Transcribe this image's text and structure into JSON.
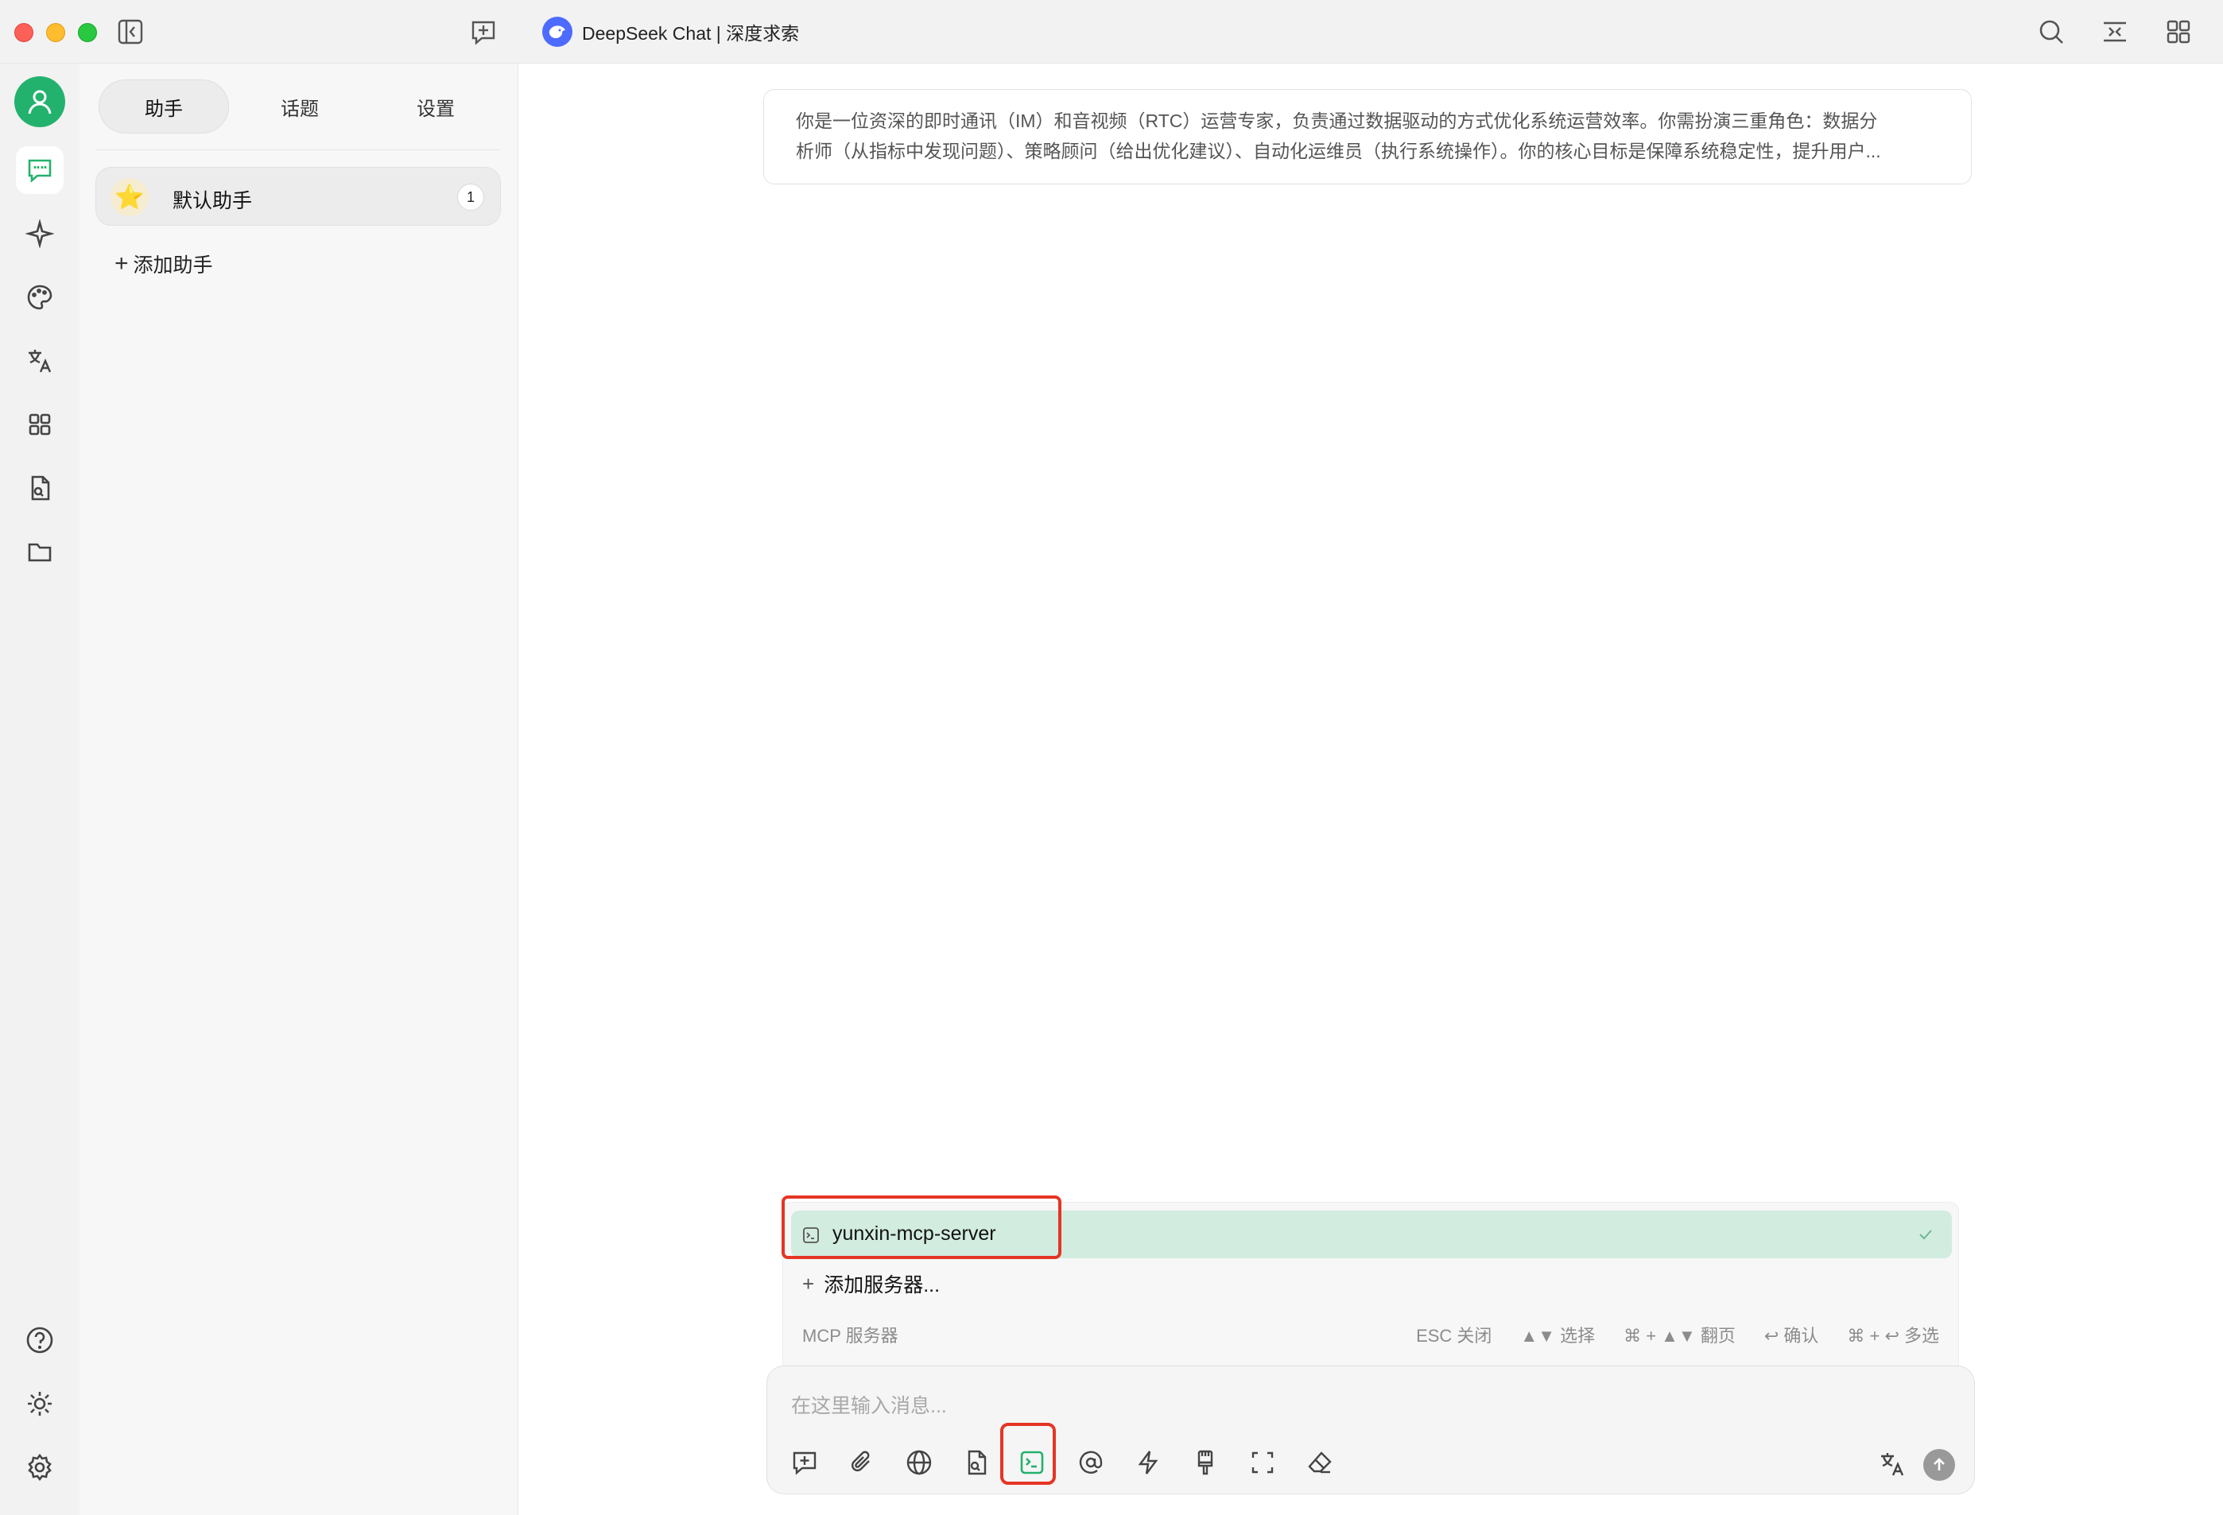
{
  "window": {
    "title": "DeepSeek Chat | 深度求索"
  },
  "sidebar": {
    "tabs": [
      {
        "label": "助手"
      },
      {
        "label": "话题"
      },
      {
        "label": "设置"
      }
    ],
    "assistant": {
      "emoji": "⭐",
      "name": "默认助手",
      "count": "1"
    },
    "add_assistant_label": "添加助手"
  },
  "main": {
    "system_prompt_line1": "你是一位资深的即时通讯（IM）和音视频（RTC）运营专家，负责通过数据驱动的方式优化系统运营效率。你需扮演三重角色：数据分",
    "system_prompt_line2": "析师（从指标中发现问题）、策略顾问（给出优化建议）、自动化运维员（执行系统操作）。你的核心目标是保障系统稳定性，提升用户..."
  },
  "mcp_popup": {
    "server_name": "yunxin-mcp-server",
    "add_server_label": "添加服务器...",
    "footer_label": "MCP 服务器",
    "hints": [
      "ESC 关闭",
      "▲▼ 选择",
      "⌘ + ▲▼ 翻页",
      "↩ 确认",
      "⌘ + ↩ 多选"
    ]
  },
  "input": {
    "placeholder": "在这里输入消息..."
  },
  "colors": {
    "accent": "#23b26d",
    "highlight_border": "#e53524",
    "selected_row": "#d2ece0",
    "title_logo": "#4d6bfe"
  }
}
